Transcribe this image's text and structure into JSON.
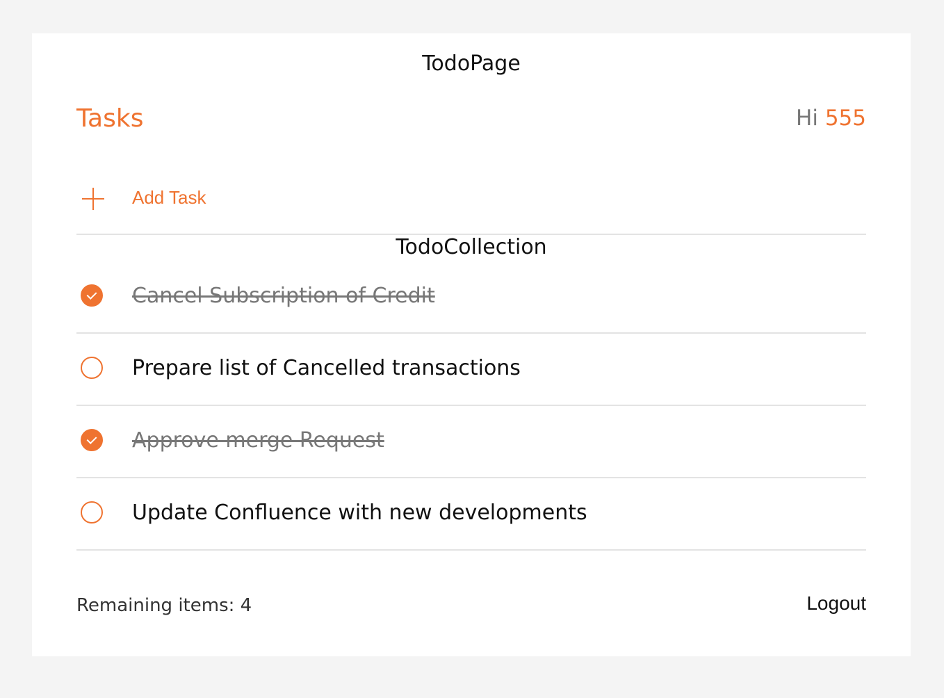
{
  "page": {
    "title": "TodoPage"
  },
  "header": {
    "heading": "Tasks",
    "greeting_prefix": "Hi",
    "username": "555"
  },
  "add_task": {
    "icon": "plus-icon",
    "label": "Add Task"
  },
  "collection": {
    "title": "TodoCollection",
    "items": [
      {
        "text": "Cancel Subscription of Credit",
        "completed": true
      },
      {
        "text": "Prepare list of Cancelled transactions",
        "completed": false
      },
      {
        "text": "Approve merge Request",
        "completed": true
      },
      {
        "text": "Update Confluence with new developments",
        "completed": false
      }
    ]
  },
  "footer": {
    "remaining_text": "Remaining items: 4",
    "logout_label": "Logout"
  },
  "colors": {
    "accent": "#ef7330",
    "background": "#f4f4f4",
    "card": "#ffffff",
    "divider": "#e3e3e3",
    "completed_text": "#777777"
  }
}
